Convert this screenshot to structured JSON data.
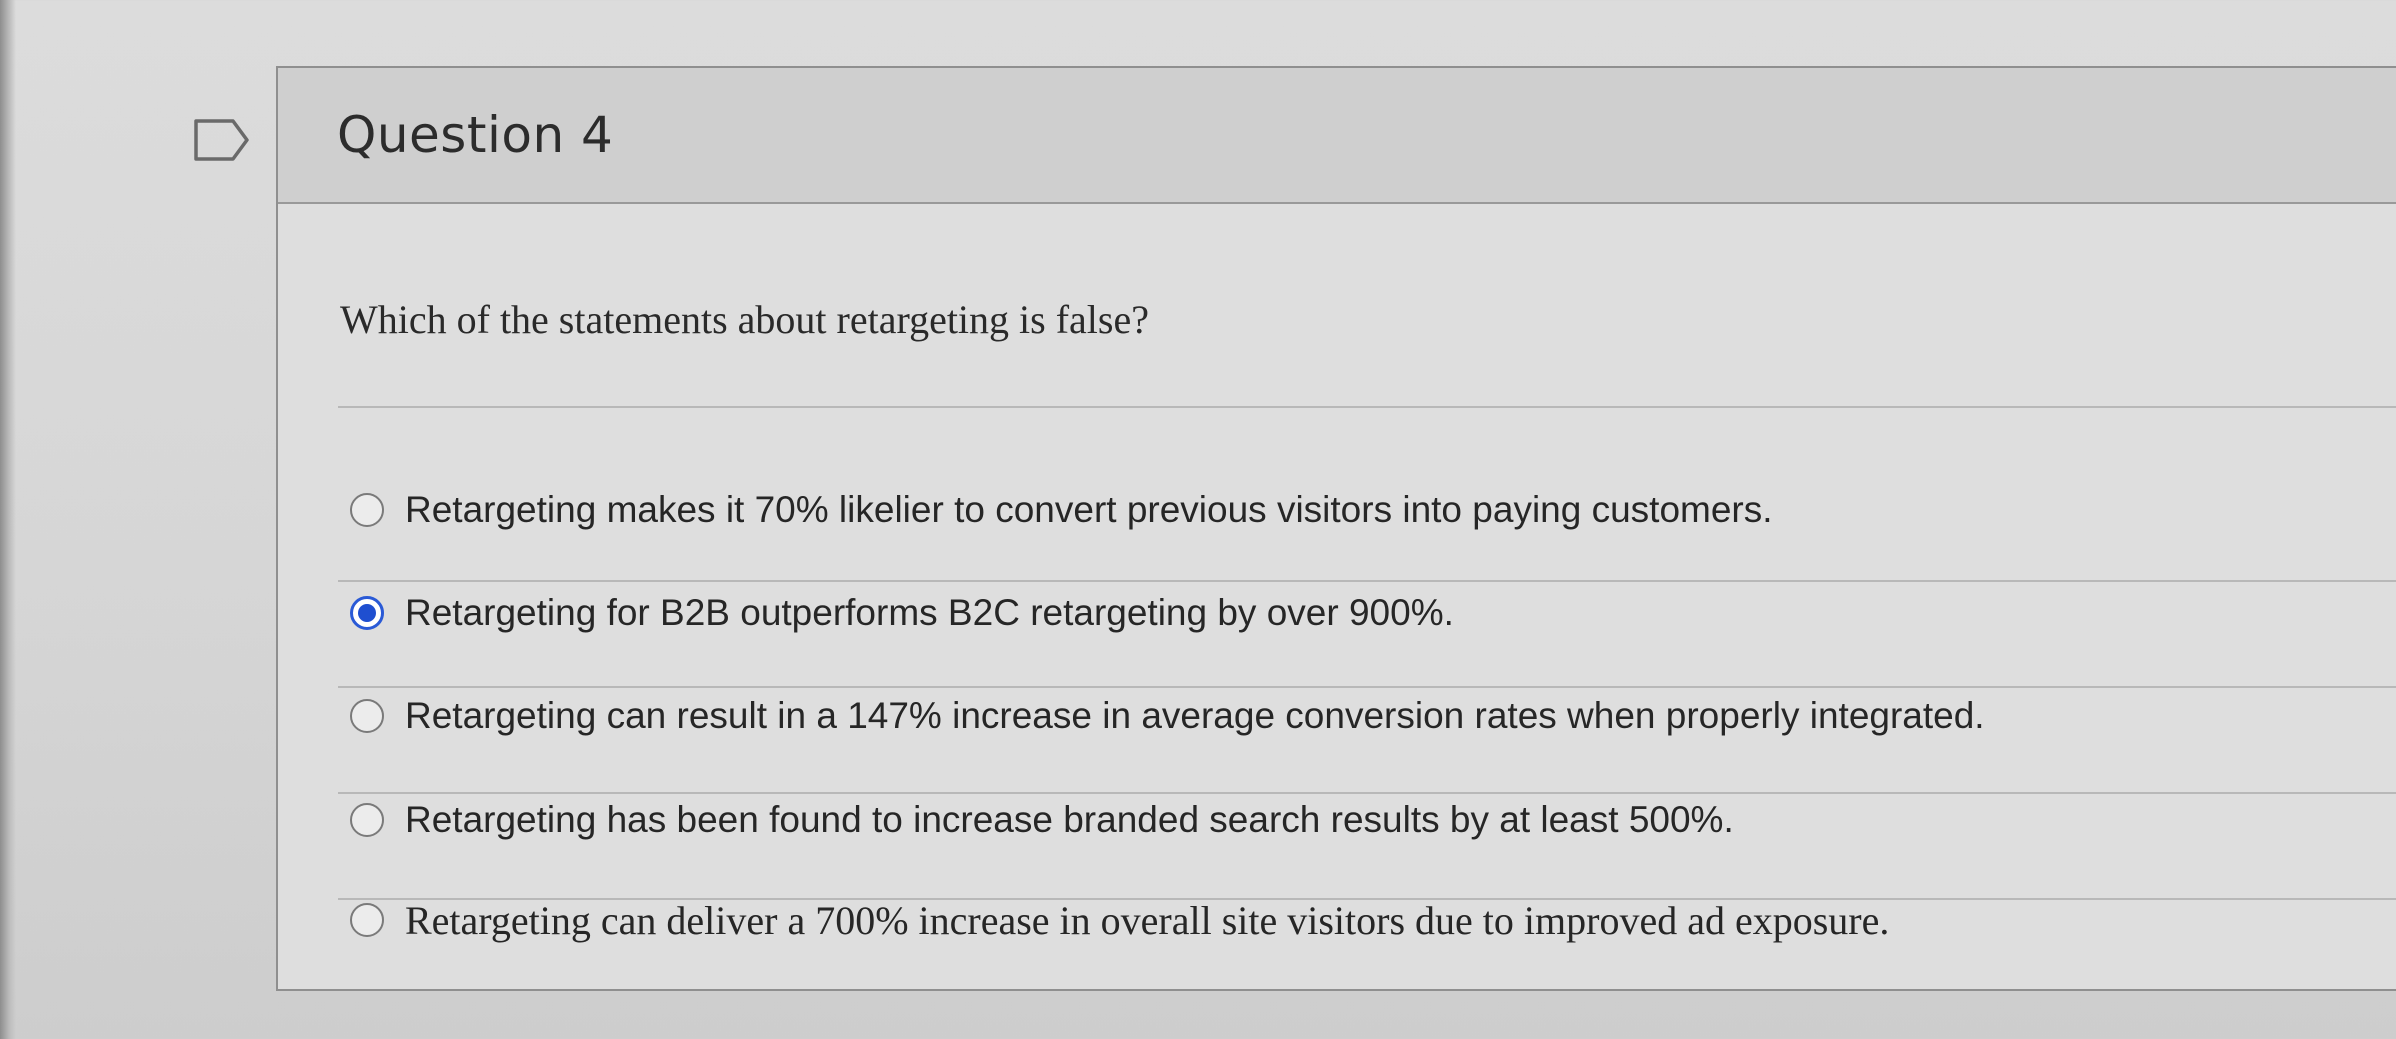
{
  "question": {
    "title": "Question 4",
    "text": "Which of the statements about retargeting is false?"
  },
  "answers": [
    {
      "label": "Retargeting makes it 70% likelier to convert previous visitors into paying customers.",
      "selected": false
    },
    {
      "label": "Retargeting for B2B outperforms B2C retargeting by over 900%.",
      "selected": true
    },
    {
      "label": "Retargeting can result in a 147% increase in average conversion rates when properly integrated.",
      "selected": false
    },
    {
      "label": "Retargeting has been found to increase branded search results by at least 500%.",
      "selected": false
    },
    {
      "label": "Retargeting can deliver a 700% increase in overall site visitors due to improved ad exposure.",
      "selected": false
    }
  ],
  "icons": {
    "flag": "flag-outline-icon"
  },
  "colors": {
    "selected_radio": "#1f4fd0",
    "card_header_bg": "#cfcfcf",
    "card_bg": "#dedede"
  }
}
